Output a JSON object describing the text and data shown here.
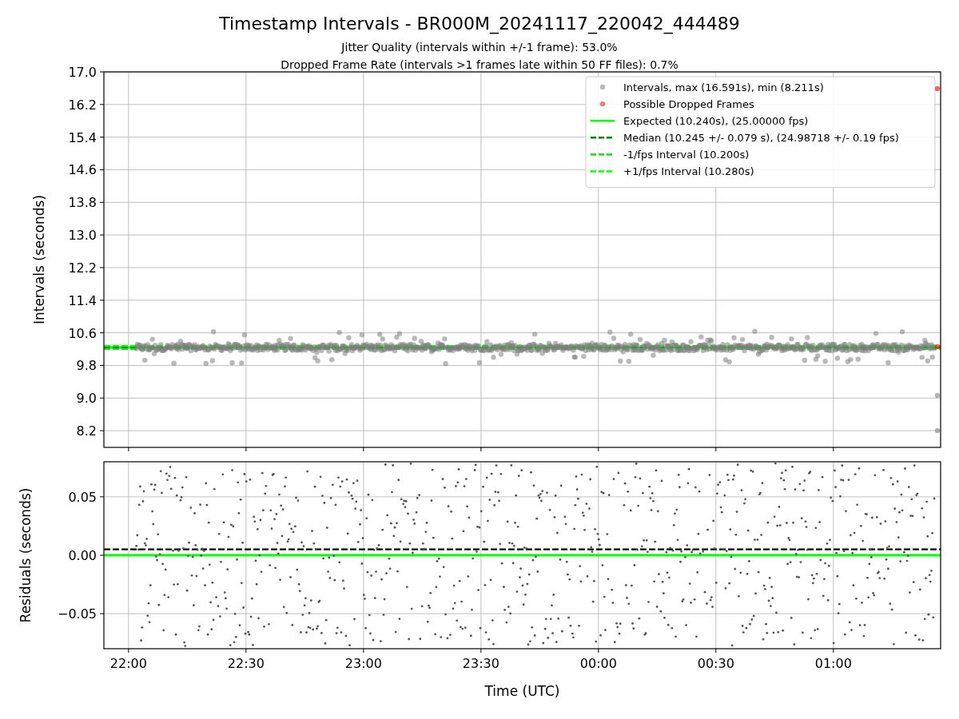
{
  "figure": {
    "title": "Timestamp Intervals - BR000M_20241117_220042_444489",
    "subtitles": [
      "Jitter Quality (intervals within +/-1 frame): 53.0%",
      "Dropped Frame Rate (intervals >1 frames late within 50 FF files): 0.7%"
    ]
  },
  "intervals_plot": {
    "chart_data": {
      "type": "scatter",
      "ylabel": "Intervals (seconds)",
      "ylim": [
        7.79,
        17.0
      ],
      "grid": true,
      "legend": "upper right",
      "yticks": [
        {
          "value": 8.2,
          "label": "8.2"
        },
        {
          "value": 9.0,
          "label": "9.0"
        },
        {
          "value": 9.8,
          "label": "9.8"
        },
        {
          "value": 10.6,
          "label": "10.6"
        },
        {
          "value": 11.4,
          "label": "11.4"
        },
        {
          "value": 12.2,
          "label": "12.2"
        },
        {
          "value": 13.0,
          "label": "13.0"
        },
        {
          "value": 13.8,
          "label": "13.8"
        },
        {
          "value": 14.6,
          "label": "14.6"
        },
        {
          "value": 15.4,
          "label": "15.4"
        },
        {
          "value": 16.2,
          "label": "16.2"
        },
        {
          "value": 17.0,
          "label": "17.0"
        }
      ],
      "series": [
        {
          "name": "Intervals, max (16.591s), min (8.211s)",
          "color": "#808080"
        },
        {
          "name": "Possible Dropped Frames",
          "color": "#ff0000"
        }
      ],
      "ref_lines": [
        {
          "axis": "y",
          "value": 10.24,
          "label": "Expected (10.240s), (25.00000 fps)",
          "color": "#00ff00"
        },
        {
          "axis": "y",
          "value": 10.245,
          "label": "Median (10.245 +/- 0.079 s), (24.98718 +/- 0.19 fps)",
          "color": "#008000"
        },
        {
          "axis": "y",
          "value": 10.2,
          "label": "-1/fps Interval (10.200s)",
          "color": "#22dd22"
        },
        {
          "axis": "y",
          "value": 10.28,
          "label": "+1/fps Interval (10.280s)",
          "color": "#00ff00"
        }
      ]
    }
  },
  "residuals_plot": {
    "chart_data": {
      "type": "scatter",
      "xlabel": "Time (UTC)",
      "ylabel": "Residuals (seconds)",
      "ylim": [
        -0.08,
        0.08
      ],
      "grid": true,
      "categories": [
        "22:00",
        "22:30",
        "23:00",
        "23:30",
        "00:00",
        "00:30",
        "01:00"
      ],
      "yticks": [
        {
          "value": 0.05,
          "label": "0.05"
        },
        {
          "value": 0,
          "label": "0.00"
        },
        {
          "value": -0.05,
          "label": "−0.05"
        }
      ],
      "ref_lines": [
        {
          "axis": "y",
          "value": 0,
          "color": "#00ff00"
        },
        {
          "axis": "y",
          "value": 0.005,
          "color": "#000000"
        }
      ]
    }
  }
}
